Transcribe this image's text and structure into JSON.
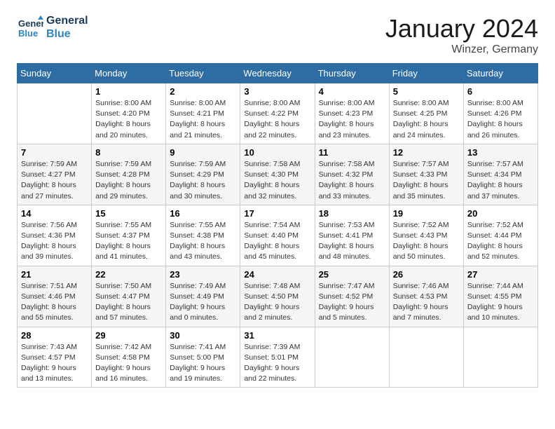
{
  "header": {
    "logo_line1": "General",
    "logo_line2": "Blue",
    "title": "January 2024",
    "subtitle": "Winzer, Germany"
  },
  "columns": [
    "Sunday",
    "Monday",
    "Tuesday",
    "Wednesday",
    "Thursday",
    "Friday",
    "Saturday"
  ],
  "weeks": [
    [
      {
        "day": null,
        "info": null
      },
      {
        "day": "1",
        "info": "Sunrise: 8:00 AM\nSunset: 4:20 PM\nDaylight: 8 hours\nand 20 minutes."
      },
      {
        "day": "2",
        "info": "Sunrise: 8:00 AM\nSunset: 4:21 PM\nDaylight: 8 hours\nand 21 minutes."
      },
      {
        "day": "3",
        "info": "Sunrise: 8:00 AM\nSunset: 4:22 PM\nDaylight: 8 hours\nand 22 minutes."
      },
      {
        "day": "4",
        "info": "Sunrise: 8:00 AM\nSunset: 4:23 PM\nDaylight: 8 hours\nand 23 minutes."
      },
      {
        "day": "5",
        "info": "Sunrise: 8:00 AM\nSunset: 4:25 PM\nDaylight: 8 hours\nand 24 minutes."
      },
      {
        "day": "6",
        "info": "Sunrise: 8:00 AM\nSunset: 4:26 PM\nDaylight: 8 hours\nand 26 minutes."
      }
    ],
    [
      {
        "day": "7",
        "info": "Sunrise: 7:59 AM\nSunset: 4:27 PM\nDaylight: 8 hours\nand 27 minutes."
      },
      {
        "day": "8",
        "info": "Sunrise: 7:59 AM\nSunset: 4:28 PM\nDaylight: 8 hours\nand 29 minutes."
      },
      {
        "day": "9",
        "info": "Sunrise: 7:59 AM\nSunset: 4:29 PM\nDaylight: 8 hours\nand 30 minutes."
      },
      {
        "day": "10",
        "info": "Sunrise: 7:58 AM\nSunset: 4:30 PM\nDaylight: 8 hours\nand 32 minutes."
      },
      {
        "day": "11",
        "info": "Sunrise: 7:58 AM\nSunset: 4:32 PM\nDaylight: 8 hours\nand 33 minutes."
      },
      {
        "day": "12",
        "info": "Sunrise: 7:57 AM\nSunset: 4:33 PM\nDaylight: 8 hours\nand 35 minutes."
      },
      {
        "day": "13",
        "info": "Sunrise: 7:57 AM\nSunset: 4:34 PM\nDaylight: 8 hours\nand 37 minutes."
      }
    ],
    [
      {
        "day": "14",
        "info": "Sunrise: 7:56 AM\nSunset: 4:36 PM\nDaylight: 8 hours\nand 39 minutes."
      },
      {
        "day": "15",
        "info": "Sunrise: 7:55 AM\nSunset: 4:37 PM\nDaylight: 8 hours\nand 41 minutes."
      },
      {
        "day": "16",
        "info": "Sunrise: 7:55 AM\nSunset: 4:38 PM\nDaylight: 8 hours\nand 43 minutes."
      },
      {
        "day": "17",
        "info": "Sunrise: 7:54 AM\nSunset: 4:40 PM\nDaylight: 8 hours\nand 45 minutes."
      },
      {
        "day": "18",
        "info": "Sunrise: 7:53 AM\nSunset: 4:41 PM\nDaylight: 8 hours\nand 48 minutes."
      },
      {
        "day": "19",
        "info": "Sunrise: 7:52 AM\nSunset: 4:43 PM\nDaylight: 8 hours\nand 50 minutes."
      },
      {
        "day": "20",
        "info": "Sunrise: 7:52 AM\nSunset: 4:44 PM\nDaylight: 8 hours\nand 52 minutes."
      }
    ],
    [
      {
        "day": "21",
        "info": "Sunrise: 7:51 AM\nSunset: 4:46 PM\nDaylight: 8 hours\nand 55 minutes."
      },
      {
        "day": "22",
        "info": "Sunrise: 7:50 AM\nSunset: 4:47 PM\nDaylight: 8 hours\nand 57 minutes."
      },
      {
        "day": "23",
        "info": "Sunrise: 7:49 AM\nSunset: 4:49 PM\nDaylight: 9 hours\nand 0 minutes."
      },
      {
        "day": "24",
        "info": "Sunrise: 7:48 AM\nSunset: 4:50 PM\nDaylight: 9 hours\nand 2 minutes."
      },
      {
        "day": "25",
        "info": "Sunrise: 7:47 AM\nSunset: 4:52 PM\nDaylight: 9 hours\nand 5 minutes."
      },
      {
        "day": "26",
        "info": "Sunrise: 7:46 AM\nSunset: 4:53 PM\nDaylight: 9 hours\nand 7 minutes."
      },
      {
        "day": "27",
        "info": "Sunrise: 7:44 AM\nSunset: 4:55 PM\nDaylight: 9 hours\nand 10 minutes."
      }
    ],
    [
      {
        "day": "28",
        "info": "Sunrise: 7:43 AM\nSunset: 4:57 PM\nDaylight: 9 hours\nand 13 minutes."
      },
      {
        "day": "29",
        "info": "Sunrise: 7:42 AM\nSunset: 4:58 PM\nDaylight: 9 hours\nand 16 minutes."
      },
      {
        "day": "30",
        "info": "Sunrise: 7:41 AM\nSunset: 5:00 PM\nDaylight: 9 hours\nand 19 minutes."
      },
      {
        "day": "31",
        "info": "Sunrise: 7:39 AM\nSunset: 5:01 PM\nDaylight: 9 hours\nand 22 minutes."
      },
      {
        "day": null,
        "info": null
      },
      {
        "day": null,
        "info": null
      },
      {
        "day": null,
        "info": null
      }
    ]
  ]
}
